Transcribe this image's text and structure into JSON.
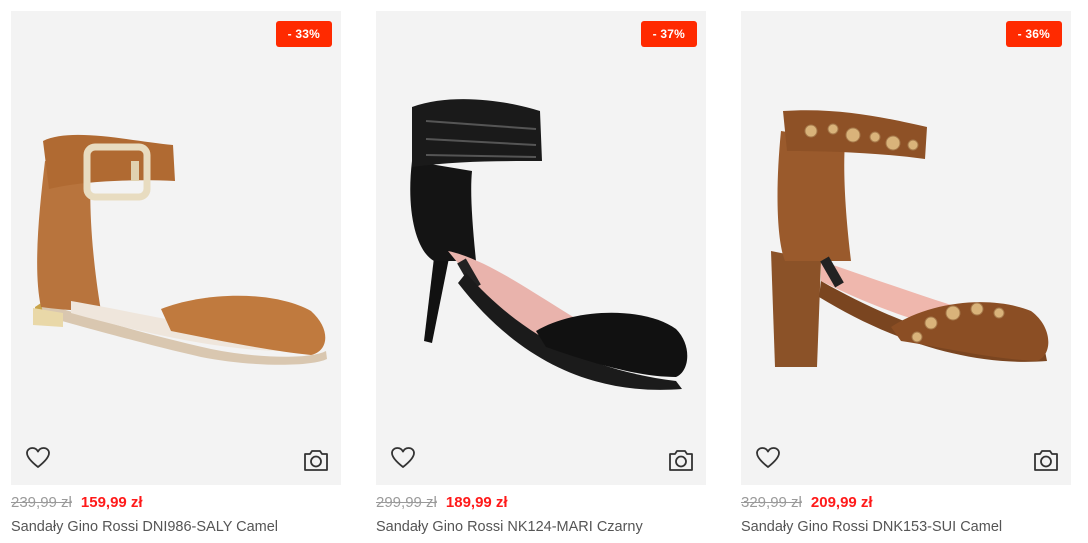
{
  "products": [
    {
      "badge": "- 33%",
      "old_price": "239,99 zł",
      "new_price": "159,99 zł",
      "name": "Sandały Gino Rossi DNI986-SALY Camel",
      "shoe_color": "#b8743d",
      "icons": {
        "favorite": "heart-outline",
        "photo": "camera"
      }
    },
    {
      "badge": "- 37%",
      "old_price": "299,99 zł",
      "new_price": "189,99 zł",
      "name": "Sandały Gino Rossi NK124-MARI Czarny",
      "shoe_color": "#111111",
      "icons": {
        "favorite": "heart-outline",
        "photo": "camera"
      }
    },
    {
      "badge": "- 36%",
      "old_price": "329,99 zł",
      "new_price": "209,99 zł",
      "name": "Sandały Gino Rossi DNK153-SUI Camel",
      "shoe_color": "#9a5a2c",
      "icons": {
        "favorite": "heart-outline",
        "photo": "camera"
      }
    }
  ],
  "colors": {
    "badge_bg": "#ff2a00",
    "new_price": "#ff1a1a",
    "old_price": "#9a9a9a",
    "card_bg": "#f3f3f3"
  }
}
